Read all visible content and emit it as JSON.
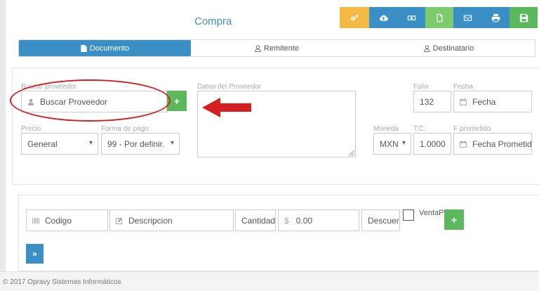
{
  "header": {
    "title": "Compra"
  },
  "toolbar": {
    "buttons": [
      {
        "name": "config-icon",
        "color": "#f4b944"
      },
      {
        "name": "cloud-upload-icon",
        "color": "#3a8fc4"
      },
      {
        "name": "money-icon",
        "color": "#3a8fc4"
      },
      {
        "name": "document-icon",
        "color": "#7dcb6c"
      },
      {
        "name": "envelope-icon",
        "color": "#3a8fc4"
      },
      {
        "name": "print-icon",
        "color": "#3a8fc4"
      },
      {
        "name": "save-icon",
        "color": "#5cb85c"
      }
    ]
  },
  "tabs": [
    {
      "label": "Documento",
      "active": true
    },
    {
      "label": "Remitente",
      "active": false
    },
    {
      "label": "Destinatario",
      "active": false
    }
  ],
  "form": {
    "proveedor": {
      "label": "Buscar proveedor",
      "placeholder": "Buscar Proveedor",
      "add_label": "+"
    },
    "datos_proveedor": {
      "label": "Datos del Proveedor"
    },
    "folio": {
      "label": "Folio",
      "value": "132"
    },
    "fecha": {
      "label": "Fecha",
      "placeholder": "Fecha"
    },
    "precio": {
      "label": "Precio",
      "value": "General"
    },
    "forma_pago": {
      "label": "Forma de pago",
      "value": "99 - Por definir."
    },
    "moneda": {
      "label": "Moneda",
      "value": "MXN"
    },
    "tc": {
      "label": "T.C.",
      "value": "1.0000"
    },
    "f_prometido": {
      "label": "F prometido",
      "placeholder": "Fecha Prometido"
    }
  },
  "items": {
    "codigo": {
      "placeholder": "Codigo"
    },
    "descripcion": {
      "placeholder": "Descripcion"
    },
    "cantidad": {
      "placeholder": "Cantidad"
    },
    "precio": {
      "placeholder": "0.00",
      "prefix": "$"
    },
    "descuento": {
      "placeholder": "Descuento"
    },
    "venta_label": "VentaPa",
    "add_label": "+",
    "next_label": "»"
  },
  "footer": {
    "text": "© 2017 Opravy Sistemas Informáticos"
  },
  "colors": {
    "accent": "#3a8fc4",
    "success": "#5cb85c",
    "warning": "#f4b944",
    "annotation": "#d42020"
  }
}
